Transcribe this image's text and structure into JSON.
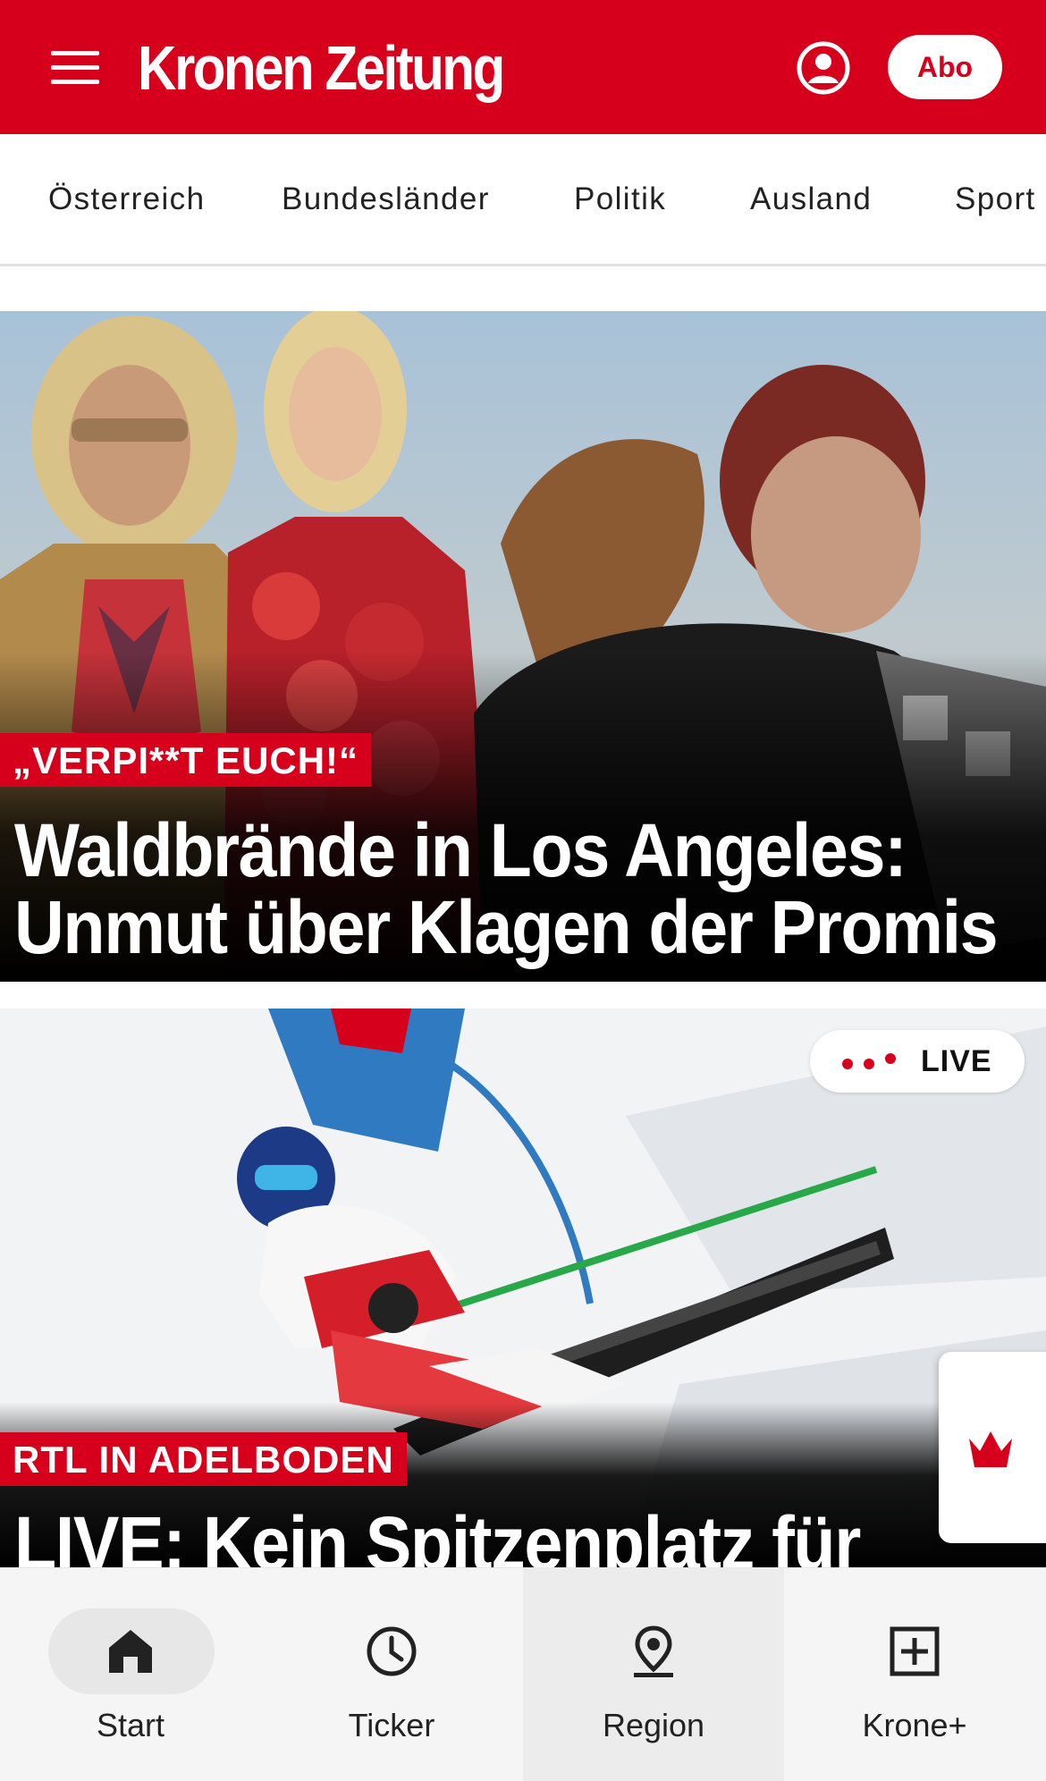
{
  "header": {
    "logo_text": "Kronen Zeitung",
    "abo_label": "Abo",
    "brand_color": "#d6001c",
    "menu_icon": "hamburger-menu-icon",
    "account_icon": "user-account-icon"
  },
  "categories": [
    "Österreich",
    "Bundesländer",
    "Politik",
    "Ausland",
    "Sport"
  ],
  "articles": [
    {
      "kicker": "„VERPI**T EUCH!“",
      "headline_line1": "Waldbrände in Los Angeles:",
      "headline_line2": "Unmut über Klagen der Promis"
    },
    {
      "kicker": "RTL IN ADELBODEN",
      "headline_line1": "LIVE: Kein Spitzenplatz für",
      "badge": "LIVE"
    }
  ],
  "bottom_nav": [
    {
      "label": "Start",
      "icon": "home-icon",
      "active": true
    },
    {
      "label": "Ticker",
      "icon": "clock-icon",
      "active": false
    },
    {
      "label": "Region",
      "icon": "location-pin-icon",
      "active": false
    },
    {
      "label": "Krone+",
      "icon": "plus-box-icon",
      "active": false
    }
  ],
  "floating_tab_icon": "crown-icon"
}
